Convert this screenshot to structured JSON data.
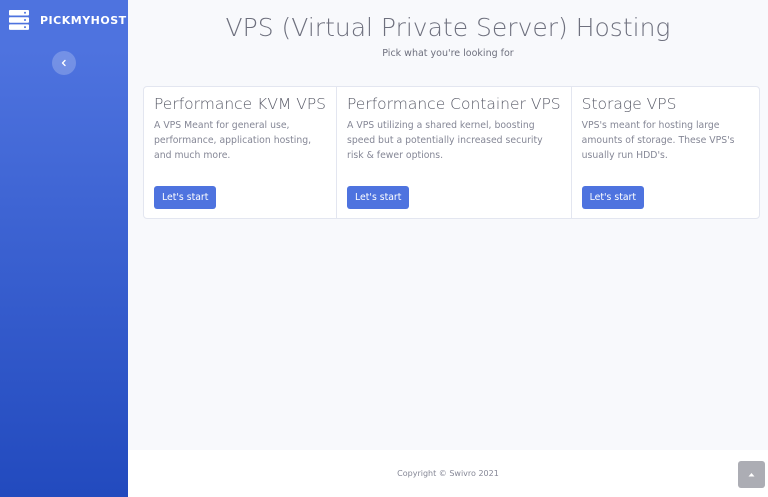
{
  "brand": {
    "name": "PICKMYHOST",
    "icon": "server-stack-icon"
  },
  "sidebar": {
    "toggle_icon": "chevron-left-icon"
  },
  "header": {
    "title": "VPS (Virtual Private Server) Hosting",
    "subtitle": "Pick what you're looking for"
  },
  "cards": [
    {
      "title": "Performance KVM VPS",
      "text": "A VPS Meant for general use, performance, application hosting, and much more.",
      "button": "Let's start"
    },
    {
      "title": "Performance Container VPS",
      "text": "A VPS utilizing a shared kernel, boosting speed but a potentially increased security risk & fewer options.",
      "button": "Let's start"
    },
    {
      "title": "Storage VPS",
      "text": "VPS's meant for hosting large amounts of storage. These VPS's usually run HDD's.",
      "button": "Let's start"
    }
  ],
  "footer": {
    "copyright": "Copyright © Swivro 2021"
  },
  "scroll_top": {
    "icon": "chevron-up-icon"
  },
  "colors": {
    "primary": "#4e73df",
    "primary_dark": "#224abe",
    "background": "#f8f9fc"
  }
}
